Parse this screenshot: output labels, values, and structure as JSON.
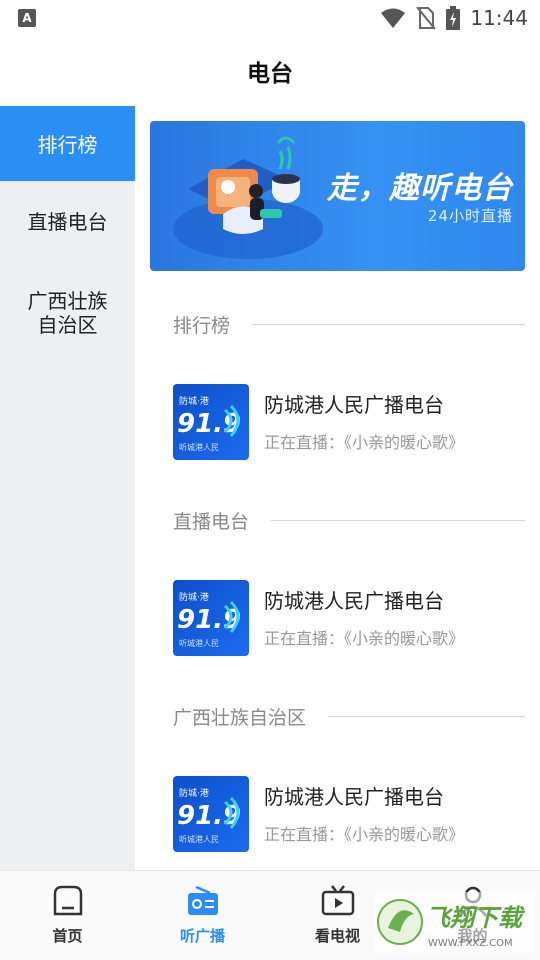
{
  "status_bar": {
    "notification_icon": "a-icon",
    "notification_letter": "A",
    "time": "11:44",
    "icons": [
      "wifi-icon",
      "no-sim-icon",
      "battery-charging-icon"
    ]
  },
  "header": {
    "title": "电台"
  },
  "sidebar": {
    "items": [
      {
        "label": "排行榜",
        "active": true
      },
      {
        "label": "直播电台",
        "active": false
      },
      {
        "label": "广西壮族自治区",
        "active": false
      }
    ]
  },
  "banner": {
    "title": "走，趣听电台",
    "subtitle": "24小时直播",
    "illustration": "person-listening-radio-illustration"
  },
  "sections": [
    {
      "title": "排行榜",
      "station": {
        "name": "防城港人民广播电台",
        "live_text": "正在直播：《小亲的暖心歌》",
        "thumb_text": "91.9"
      }
    },
    {
      "title": "直播电台",
      "station": {
        "name": "防城港人民广播电台",
        "live_text": "正在直播：《小亲的暖心歌》",
        "thumb_text": "91.9"
      }
    },
    {
      "title": "广西壮族自治区",
      "station": {
        "name": "防城港人民广播电台",
        "live_text": "正在直播：《小亲的暖心歌》",
        "thumb_text": "91.9"
      }
    }
  ],
  "bottom_nav": {
    "items": [
      {
        "label": "首页",
        "icon": "home-icon",
        "active": false
      },
      {
        "label": "听广播",
        "icon": "radio-icon",
        "active": true
      },
      {
        "label": "看电视",
        "icon": "tv-icon",
        "active": false
      },
      {
        "label": "我的",
        "icon": "user-icon",
        "active": false
      }
    ]
  },
  "watermark": {
    "text": "飞翔下载",
    "url_text": "WWW.FXXZ.COM"
  },
  "colors": {
    "accent": "#2b8ef5",
    "sidebar_bg": "#eeeff2",
    "banner_start": "#2a76e0"
  }
}
